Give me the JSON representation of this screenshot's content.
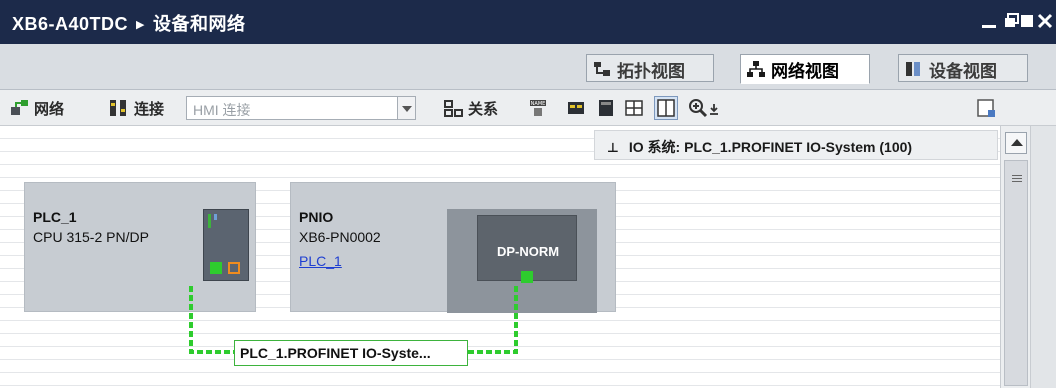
{
  "window": {
    "project": "XB6-A40TDC",
    "separator": "▶",
    "section": "设备和网络"
  },
  "view_tabs": [
    {
      "label": "拓扑视图",
      "icon": "topology-view-icon",
      "active": false
    },
    {
      "label": "网络视图",
      "icon": "network-view-icon",
      "active": true
    },
    {
      "label": "设备视图",
      "icon": "device-view-icon",
      "active": false
    }
  ],
  "toolbar": {
    "network_label": "网络",
    "connections_label": "连接",
    "connection_type_value": "HMI 连接",
    "relations_label": "关系"
  },
  "io_system": {
    "pin_glyph": "⊥",
    "label": "IO 系统: PLC_1.PROFINET IO-System (100)"
  },
  "devices": {
    "plc": {
      "name": "PLC_1",
      "type": "CPU 315-2 PN/DP"
    },
    "pnio": {
      "name": "PNIO",
      "type": "XB6-PN0002",
      "link": "PLC_1",
      "module_label": "DP-NORM"
    }
  },
  "network_label": "PLC_1.PROFINET IO-Syste...",
  "colors": {
    "titlebar": "#1c2a4a",
    "network_green": "#3db33d",
    "port_orange": "#f08c1e",
    "link_blue": "#1f3fd1"
  }
}
